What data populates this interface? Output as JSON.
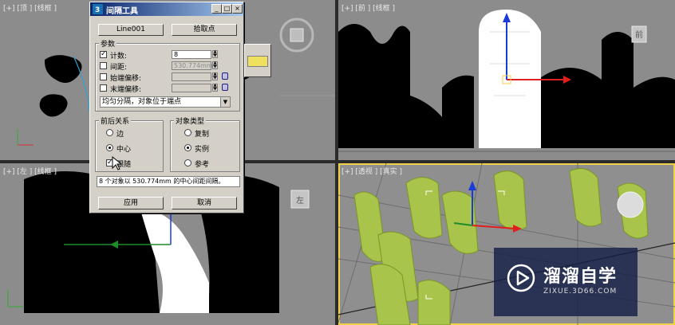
{
  "viewports": {
    "top": {
      "label": "[+] [顶 ] [线框 ]"
    },
    "front": {
      "label": "[+] [前 ] [线框 ]"
    },
    "left": {
      "label": "[+] [左 ] [线框 ]"
    },
    "perspective": {
      "label": "[+] [透视 ] [真实 ]"
    }
  },
  "viewcube": {
    "front_face": "前",
    "left_face": "左"
  },
  "dialog": {
    "title": "间隔工具",
    "controls": {
      "minimize": "_",
      "maximize": "□",
      "close": "×"
    },
    "path_button": "Line001",
    "pick_points_button": "拾取点",
    "params": {
      "title": "参数",
      "count": {
        "label": "计数:",
        "checked": true,
        "value": "8"
      },
      "spacing": {
        "label": "间距:",
        "checked": false,
        "value": "530.774mm"
      },
      "start_offset": {
        "label": "始端偏移:",
        "checked": false,
        "value": ""
      },
      "end_offset": {
        "label": "末端偏移:",
        "checked": false,
        "value": ""
      },
      "distribution": "均匀分隔，对象位于端点"
    },
    "context": {
      "title": "前后关系",
      "options": [
        "边",
        "中心"
      ],
      "selected": "中心",
      "follow": {
        "label": "跟随",
        "checked": true
      }
    },
    "object_type": {
      "title": "对象类型",
      "options": [
        "复制",
        "实例",
        "参考"
      ],
      "selected": "实例"
    },
    "status": "8 个对象以 530.774mm 的中心间距间隔。",
    "apply_button": "应用",
    "cancel_button": "取消"
  },
  "watermark": {
    "title": "溜溜自学",
    "url": "ZIXUE.3D66.COM"
  }
}
